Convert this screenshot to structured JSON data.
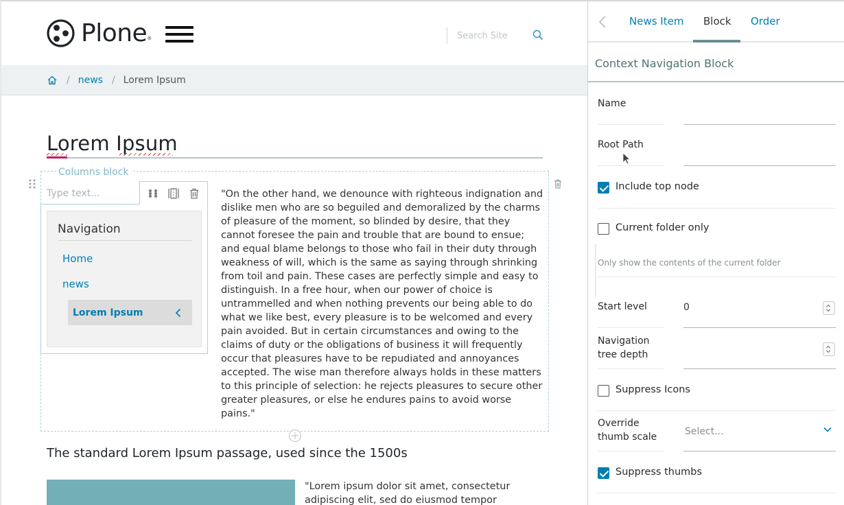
{
  "header": {
    "logo_text": "Plone",
    "logo_reg": "®",
    "search_placeholder": "Search Site"
  },
  "breadcrumbs": {
    "items": [
      "news",
      "Lorem Ipsum"
    ],
    "separator": "/"
  },
  "page": {
    "title": "Lorem Ipsum",
    "columns_block_label": "Columns block",
    "type_text_placeholder": "Type text...",
    "navigation": {
      "heading": "Navigation",
      "items": [
        "Home",
        "news"
      ],
      "active_item": "Lorem Ipsum"
    },
    "paragraph": "\"On the other hand, we denounce with righteous indignation and dislike men who are so beguiled and demoralized by the charms of pleasure of the moment, so blinded by desire, that they cannot foresee the pain and trouble that are bound to ensue; and equal blame belongs to those who fail in their duty through weakness of will, which is the same as saying through shrinking from toil and pain. These cases are perfectly simple and easy to distinguish. In a free hour, when our power of choice is untrammelled and when nothing prevents our being able to do what we like best, every pleasure is to be welcomed and every pain avoided. But in certain circumstances and owing to the claims of duty or the obligations of business it will frequently occur that pleasures have to be repudiated and annoyances accepted. The wise man therefore always holds in these matters to this principle of selection: he rejects pleasures to secure other greater pleasures, or else he endures pains to avoid worse pains.\"",
    "subheading": "The standard Lorem Ipsum passage, used since the 1500s",
    "paragraph2": "\"Lorem ipsum dolor sit amet, consectetur adipiscing elit, sed do eiusmod tempor incididunt"
  },
  "sidebar": {
    "tabs": [
      "News Item",
      "Block",
      "Order"
    ],
    "active_tab": "Block",
    "title": "Context Navigation Block",
    "fields": {
      "name_label": "Name",
      "name_value": "",
      "root_path_label": "Root Path",
      "root_path_value": "",
      "include_top_node_label": "Include top node",
      "include_top_node_checked": true,
      "current_folder_only_label": "Current folder only",
      "current_folder_only_checked": false,
      "current_folder_only_help": "Only show the contents of the current folder",
      "start_level_label": "Start level",
      "start_level_value": "0",
      "nav_tree_depth_label_1": "Navigation",
      "nav_tree_depth_label_2": "tree depth",
      "nav_tree_depth_value": "",
      "suppress_icons_label": "Suppress Icons",
      "suppress_icons_checked": false,
      "override_thumb_label_1": "Override",
      "override_thumb_label_2": "thumb scale",
      "override_thumb_placeholder": "Select...",
      "suppress_thumbs_label": "Suppress thumbs",
      "suppress_thumbs_checked": true
    }
  },
  "colors": {
    "link": "#007eb1",
    "accent": "#c31b6b",
    "sidebar_title": "#4f7377",
    "teal_image": "#72afb6"
  }
}
